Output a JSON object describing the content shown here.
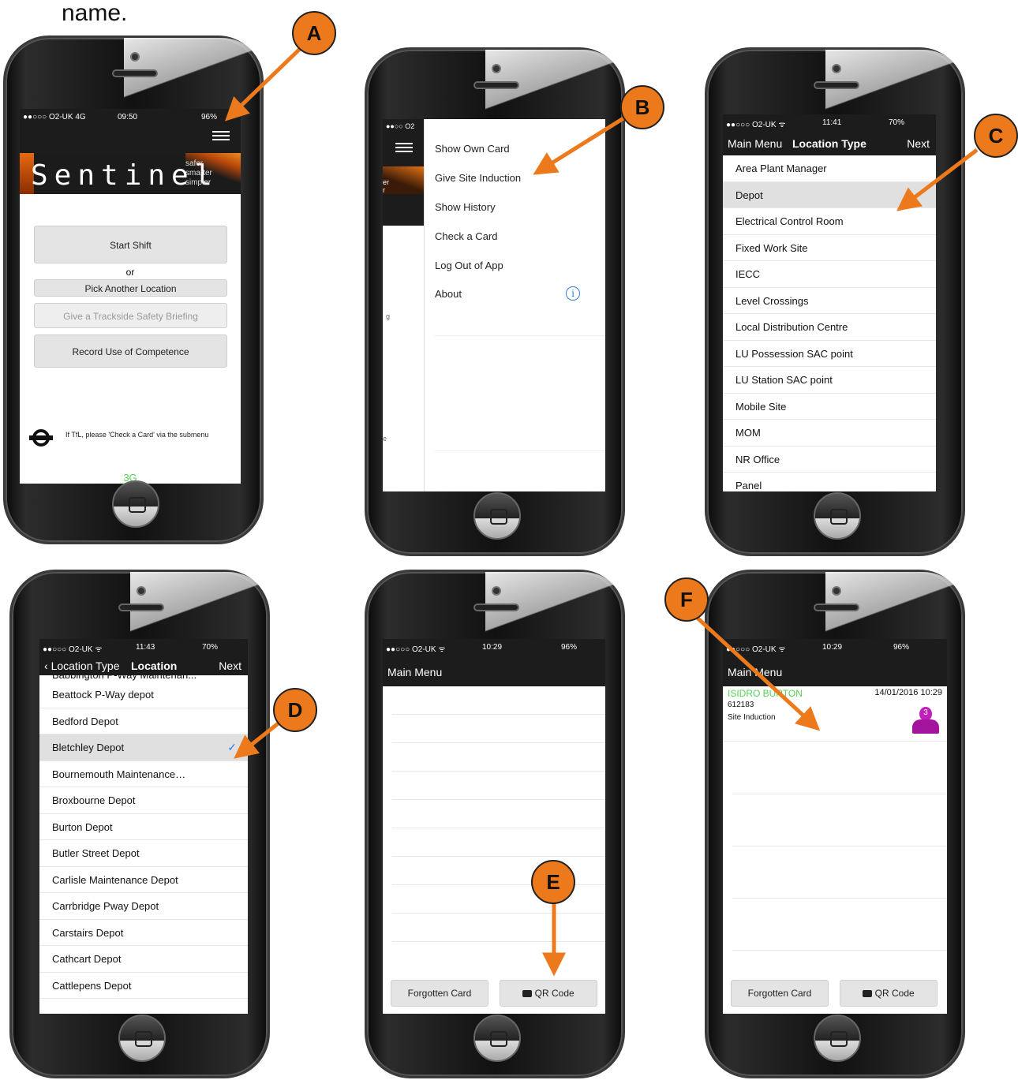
{
  "caption": "name.",
  "labels": [
    "A",
    "B",
    "C",
    "D",
    "E",
    "F"
  ],
  "colors": {
    "accent": "#ec7a1c",
    "statusbar": "#1c1c1c",
    "check": "#2f7de1",
    "green": "#54d154"
  },
  "phone1": {
    "status": {
      "carrier": "●●○○○ O2-UK  4G",
      "time": "09:50",
      "battery": "96%"
    },
    "brand": "Sentinel",
    "tagline": [
      "safer",
      "smarter",
      "simpler"
    ],
    "start_shift": "Start Shift",
    "or": "or",
    "pick_location": "Pick Another Location",
    "briefing": "Give a Trackside Safety Briefing",
    "record_competence": "Record Use of Competence",
    "tfl_note": "If TfL, please 'Check a Card' via the submenu",
    "network": "3G"
  },
  "phone2": {
    "status_carrier": "●●○○ O2",
    "menu": [
      "Show Own Card",
      "Give Site Induction",
      "Show History",
      "Check a Card",
      "Log Out of App",
      "About"
    ],
    "peek_text": [
      "er",
      "r",
      "g",
      "e"
    ]
  },
  "phone3": {
    "status": {
      "carrier": "●●○○○ O2-UK ᯤ",
      "time": "11:41",
      "battery": "70%"
    },
    "nav": {
      "back": "Main Menu",
      "title": "Location Type",
      "next": "Next"
    },
    "items": [
      "Area Plant Manager",
      "Depot",
      "Electrical Control Room",
      "Fixed Work Site",
      "IECC",
      "Level Crossings",
      "Local Distribution Centre",
      "LU Possession SAC point",
      "LU Station SAC point",
      "Mobile Site",
      "MOM",
      "NR Office",
      "Panel"
    ],
    "selected_index": 1
  },
  "phone4": {
    "status": {
      "carrier": "●●○○○ O2-UK ᯤ",
      "time": "11:43",
      "battery": "70%"
    },
    "nav": {
      "back": "Location Type",
      "title": "Location",
      "next": "Next"
    },
    "partial_top": "Babbington P-Way Maintenan...",
    "items": [
      "Beattock P-Way depot",
      "Bedford Depot",
      "Bletchley Depot",
      "Bournemouth Maintenance…",
      "Broxbourne Depot",
      "Burton Depot",
      "Butler Street Depot",
      "Carlisle Maintenance Depot",
      "Carrbridge Pway Depot",
      "Carstairs Depot",
      "Cathcart Depot",
      "Cattlepens Depot"
    ],
    "selected_index": 2
  },
  "phone5": {
    "status": {
      "carrier": "●●○○○ O2-UK ᯤ",
      "time": "10:29",
      "battery": "96%"
    },
    "nav_title": "Main Menu",
    "forgotten": "Forgotten Card",
    "qr": "QR Code"
  },
  "phone6": {
    "status": {
      "carrier": "●●○○○ O2-UK ᯤ",
      "time": "10:29",
      "battery": "96%"
    },
    "nav_title": "Main Menu",
    "record": {
      "name": "ISIDRO BURTON",
      "datetime": "14/01/2016 10:29",
      "id": "612183",
      "type": "Site Induction",
      "badge": "3"
    },
    "forgotten": "Forgotten Card",
    "qr": "QR Code"
  }
}
